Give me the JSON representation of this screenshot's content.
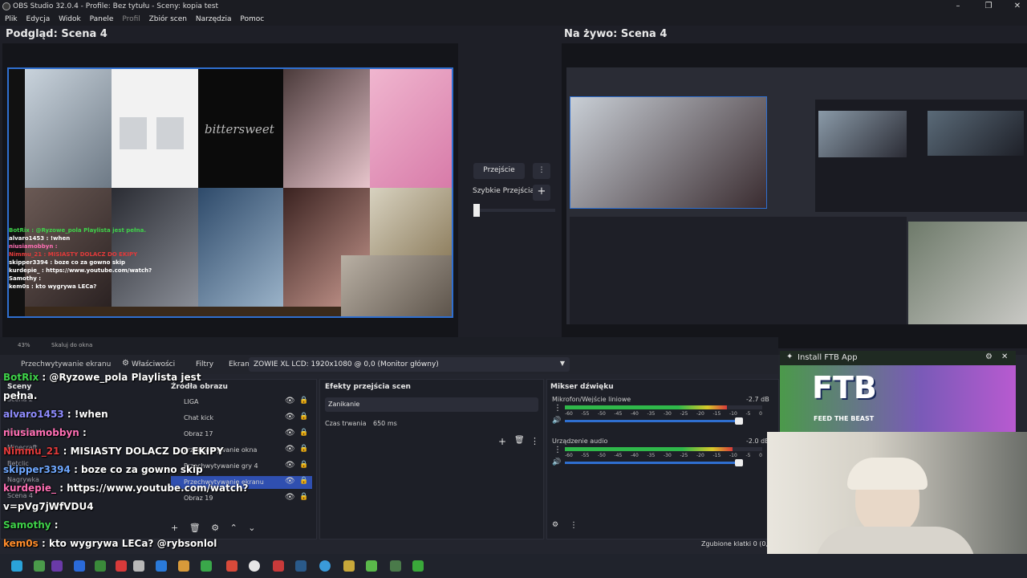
{
  "window": {
    "title": "OBS Studio 32.0.4 - Profile: Bez tytułu - Sceny: kopia test",
    "minimize": "–",
    "maximize": "❐",
    "close": "✕"
  },
  "menu": [
    "Plik",
    "Edycja",
    "Widok",
    "Panele",
    "Profil",
    "Zbiór scen",
    "Narzędzia",
    "Pomoc"
  ],
  "preview": {
    "title": "Podgląd: Scena 4",
    "zoom": "43%",
    "scale_label": "Skaluj do okna"
  },
  "live": {
    "title": "Na żywo: Scena 4"
  },
  "transition": {
    "button_label": "Przejście",
    "quick_label": "Szybkie Przejścia",
    "plus": "+",
    "kebab": "⋮"
  },
  "source_toolbar": {
    "source_name": "Przechwytywanie ekranu",
    "properties": "Właściwości",
    "filters": "Filtry",
    "screen_label": "Ekran",
    "screen_value": "ZOWIE XL LCD: 1920x1080 @ 0,0 (Monitor główny)"
  },
  "scenes": {
    "title": "Sceny",
    "items": [
      "Scena 2",
      "Scena 3",
      "Nagrywanie",
      "Minecraft",
      "Betclic",
      "Nagrywka",
      "Scena 4"
    ]
  },
  "sources": {
    "title": "Źródła obrazu",
    "items": [
      "LIGA",
      "Chat kick",
      "Obraz 17",
      "Przechwytywanie okna",
      "Przechwytywanie gry 4",
      "Przechwytywanie ekranu",
      "Obraz 19"
    ]
  },
  "transitions_panel": {
    "title": "Efekty przejścia scen",
    "effect": "Zanikanie",
    "duration_label": "Czas trwania",
    "duration_value": "650 ms"
  },
  "mixer": {
    "title": "Mikser dźwięku",
    "channels": [
      {
        "name": "Mikrofon/Wejście liniowe",
        "db": "-2.7 dB",
        "level": 0.82
      },
      {
        "name": "Urządzenie audio",
        "db": "-2.0 dB",
        "level": 0.85
      }
    ],
    "scale": [
      "-60",
      "-55",
      "-50",
      "-45",
      "-40",
      "-35",
      "-30",
      "-25",
      "-20",
      "-15",
      "-10",
      "-5",
      "0"
    ]
  },
  "status": {
    "dropped": "Zgubione klatki 0 (0,0"
  },
  "ftb": {
    "title": "Install FTB App",
    "logo": "FTB",
    "tagline": "FEED THE BEAST"
  },
  "chat": [
    {
      "user": "BotRix",
      "text": ": @Ryzowe_pola Playlista jest",
      "color": "#3fd24a"
    },
    {
      "user": "",
      "text": "pełna.",
      "color": "#ffffff"
    },
    {
      "user": "alvaro1453",
      "text": ": !when",
      "color": "#8f8cff"
    },
    {
      "user": "niusiamobbyn",
      "text": ":",
      "color": "#ff6fb4"
    },
    {
      "user": "Nimmu_21",
      "text": ": MISIASTY DOLACZ DO EKIPY",
      "color": "#e23a3a"
    },
    {
      "user": "skipper3394",
      "text": ": boze co za gowno skip",
      "color": "#6fa8ff"
    },
    {
      "user": "kurdepie_",
      "text": ": https://www.youtube.com/watch?",
      "color": "#ff6fb4"
    },
    {
      "user": "",
      "text": "v=pVg7jWfVDU4",
      "color": "#ffffff"
    },
    {
      "user": "Samothy",
      "text": ":",
      "color": "#3fd24a"
    },
    {
      "user": "kem0s",
      "text": ": kto wygrywa LECa? @rybsonlol",
      "color": "#ff8c2a"
    },
    {
      "user": "Nimmu_21",
      "text": ": MISIASTY DOLACZ DO EKIPY",
      "color": "#e23a3a"
    }
  ],
  "colors": {
    "accent": "#2f6fd0",
    "meter_green": "#2fb84a",
    "meter_yellow": "#d8c92a",
    "meter_red": "#d83a3a"
  }
}
